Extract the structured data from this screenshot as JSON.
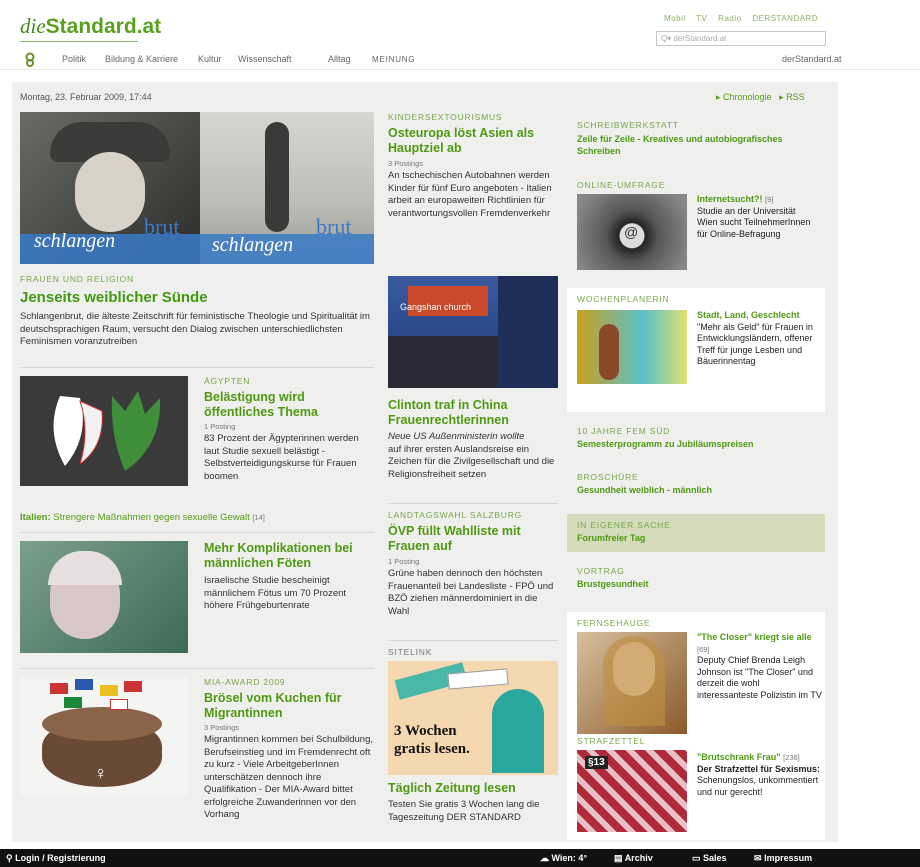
{
  "header": {
    "logo_prefix": "die",
    "logo_main": "Standard.at",
    "top_links": [
      "Mobil",
      "TV",
      "Radio",
      "DERSTANDARD"
    ],
    "search_placeholder": "Q▾ derStandard.at"
  },
  "nav": {
    "items": [
      "Politik",
      "Bildung & Karriere",
      "Kultur",
      "Wissenschaft",
      "Alltag",
      "MEINUNG"
    ],
    "right": "derStandard.at"
  },
  "meta": {
    "date": "Montag, 23. Februar 2009, 17:44",
    "links": [
      "Chronologie",
      "RSS"
    ]
  },
  "col1": {
    "feature": {
      "img_text1": "schlangen",
      "img_text2": "brut",
      "img_text3": "schlangen",
      "img_text4": "brut",
      "kicker": "FRAUEN UND RELIGION",
      "title": "Jenseits weiblicher Sünde",
      "body": "Schlangenbrut, die älteste Zeitschrift für feministische Theologie und Spiritualität im deutschsprachigen Raum, versucht den Dialog zwischen unterschiedlichsten Feminismen voranzutreiben"
    },
    "a1": {
      "kicker": "ÄGYPTEN",
      "title": "Belästigung wird öffentliches Thema",
      "meta": "1 Posting",
      "body": "83 Prozent der Ägypterinnen werden laut Studie sexuell belästigt - Selbstverteidigungskurse für Frauen boomen"
    },
    "related": {
      "label": "Italien:",
      "text": "Strengere Maßnahmen gegen sexuelle Gewalt",
      "count": "[14]"
    },
    "a2": {
      "title": "Mehr Komplikationen bei männlichen Föten",
      "body": "Israelische Studie bescheinigt männlichem Fötus um 70 Prozent höhere Frühgeburtenrate"
    },
    "a3": {
      "kicker": "MIA-AWARD 2009",
      "title": "Brösel vom Kuchen für Migrantinnen",
      "meta": "3 Postings",
      "body": "Migrantinnen kommen bei Schulbildung, Berufseinstieg und im Fremdenrecht oft zu kurz - Viele ArbeitgeberInnen unterschätzen dennoch ihre Qualifikation - Der MIA-Award bittet erfolgreiche Zuwanderinnen vor den Vorhang"
    }
  },
  "col2": {
    "a1": {
      "kicker": "KINDERSEXTOURISMUS",
      "title": "Osteuropa löst Asien als Hauptziel ab",
      "meta": "3 Postings",
      "body": "An tschechischen Autobahnen werden Kinder für fünf Euro angeboten - Italien arbeit an europaweiten Richtlinien für verantwortungsvollen Fremdenverkehr"
    },
    "a2": {
      "img_text": "Gangshan church",
      "title": "Clinton traf in China Frauenrechtlerinnen",
      "lead": "Neue US Außenministerin wollte",
      "body": "auf ihrer ersten Auslandsreise ein Zeichen für die Zivilgesellschaft und die Religionsfreiheit setzen"
    },
    "a3": {
      "kicker": "LANDTAGSWAHL SALZBURG",
      "title": "ÖVP füllt Wahlliste mit Frauen auf",
      "meta": "1 Posting",
      "body": "Grüne haben dennoch den höchsten Frauenanteil bei Landesliste - FPÖ und BZÖ ziehen männerdominiert in die Wahl"
    },
    "sitelink": {
      "kicker": "SITELINK",
      "ad_line1": "3 Wochen",
      "ad_line2": "gratis lesen.",
      "title": "Täglich Zeitung lesen",
      "body": "Testen Sie gratis 3 Wochen lang die Tageszeitung DER STANDARD"
    }
  },
  "col3": {
    "schreib": {
      "kicker": "SCHREIBWERKSTATT",
      "text": "Zeile für Zeile - Kreatives und autobiografisches Schreiben"
    },
    "umfrage": {
      "kicker": "ONLINE-UMFRAGE",
      "title": "Internetsucht?!",
      "count": "[9]",
      "body": "Studie an der Universität Wien sucht TeilnehmerInnen für Online-Befragung"
    },
    "wochen": {
      "kicker": "WOCHENPLANERIN",
      "title": "Stadt, Land, Geschlecht",
      "body": "\"Mehr als Geld\" für Frauen in Entwicklungsländern, offener Treff für junge Lesben und Bäuerinnentag"
    },
    "femsued": {
      "kicker": "10 JAHRE FEM SÜD",
      "text": "Semesterprogramm zu Jubiläumspreisen"
    },
    "brosch": {
      "kicker": "BROSCHÜRE",
      "text": "Gesundheit weiblich - männlich"
    },
    "eigen": {
      "kicker": "IN EIGENER SACHE",
      "text": "Forumfreier Tag"
    },
    "vortrag": {
      "kicker": "VORTRAG",
      "text": "Brustgesundheit"
    },
    "fern": {
      "kicker": "FERNSEHAUGE",
      "title": "\"The Closer\" kriegt sie alle",
      "count": "[69]",
      "body": "Deputy Chief Brenda Leigh Johnson ist \"The Closer\" und derzeit die wohl interessanteste Polizistin im TV"
    },
    "straf": {
      "kicker": "STRAFZETTEL",
      "img_label": "§13",
      "title": "\"Brutschrank Frau\"",
      "count": "[236]",
      "body1": "Der Strafzettel für Sexismus:",
      "body2": "Schenungslos, unkommentiert und nur gerecht!"
    }
  },
  "footer": {
    "login": "Login / Registrierung",
    "weather": "Wien: 4°",
    "archiv": "Archiv",
    "sales": "Sales",
    "impressum": "Impressum"
  }
}
